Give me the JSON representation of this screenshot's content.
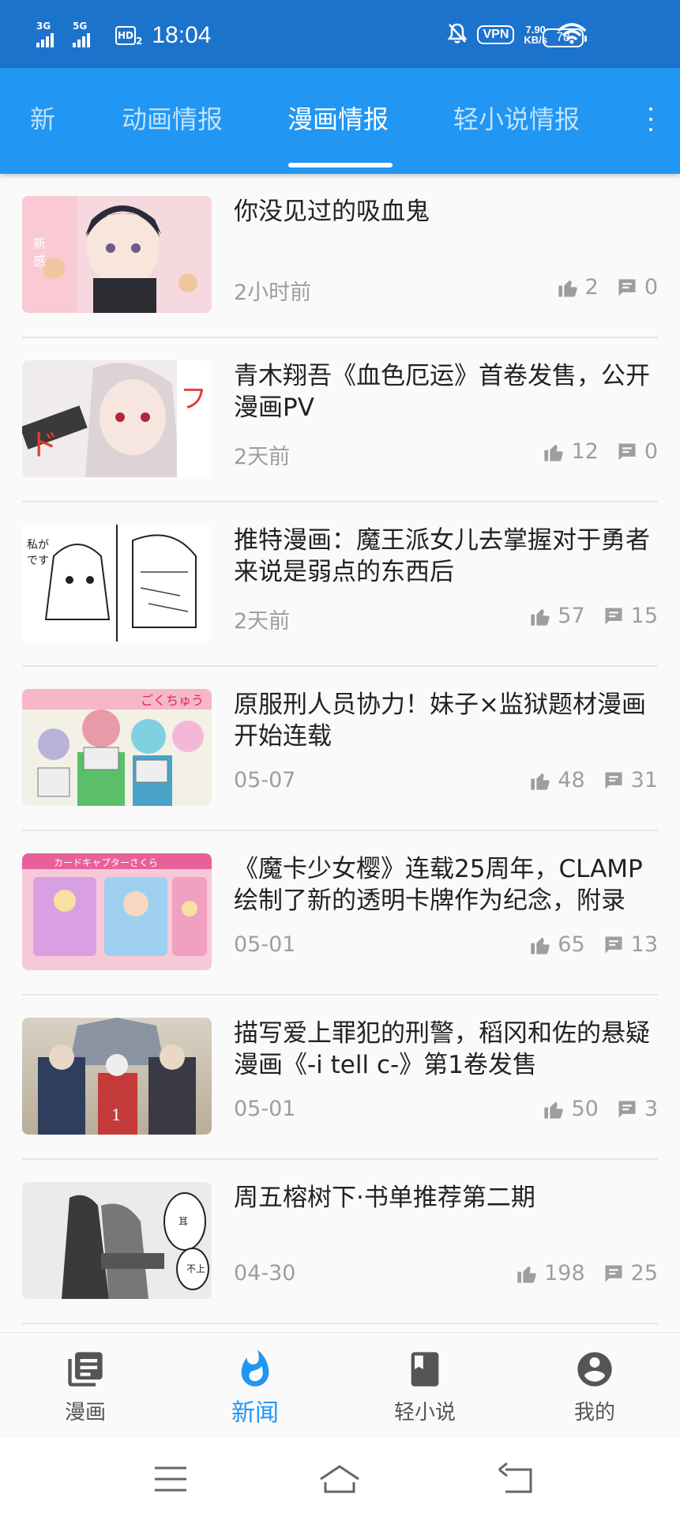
{
  "status_bar": {
    "sim1": "3G",
    "sim2": "5G",
    "hd": "HD",
    "hd_sub": "2",
    "time": "18:04",
    "vpn": "VPN",
    "net_speed_value": "7.90",
    "net_speed_unit": "KB/s",
    "battery": "78"
  },
  "tabs": [
    {
      "label": "新",
      "active": false
    },
    {
      "label": "动画情报",
      "active": false
    },
    {
      "label": "漫画情报",
      "active": true
    },
    {
      "label": "轻小说情报",
      "active": false
    }
  ],
  "news": [
    {
      "title": "你没见过的吸血鬼",
      "date": "2小时前",
      "likes": "2",
      "comments": "0"
    },
    {
      "title": "青木翔吾《血色厄运》首卷发售，公开漫画PV",
      "date": "2天前",
      "likes": "12",
      "comments": "0"
    },
    {
      "title": "推特漫画：魔王派女儿去掌握对于勇者来说是弱点的东西后",
      "date": "2天前",
      "likes": "57",
      "comments": "15"
    },
    {
      "title": "原服刑人员协力！妹子×监狱题材漫画开始连载",
      "date": "05-07",
      "likes": "48",
      "comments": "31"
    },
    {
      "title": "《魔卡少女樱》连载25周年，CLAMP绘制了新的透明卡牌作为纪念，附录",
      "date": "05-01",
      "likes": "65",
      "comments": "13"
    },
    {
      "title": "描写爱上罪犯的刑警，稻冈和佐的悬疑漫画《-i tell c-》第1卷发售",
      "date": "05-01",
      "likes": "50",
      "comments": "3"
    },
    {
      "title": "周五榕树下·书单推荐第二期",
      "date": "04-30",
      "likes": "198",
      "comments": "25"
    }
  ],
  "bottom_nav": [
    {
      "label": "漫画",
      "icon": "book-list-icon",
      "active": false
    },
    {
      "label": "新闻",
      "icon": "flame-icon",
      "active": true
    },
    {
      "label": "轻小说",
      "icon": "bookmark-book-icon",
      "active": false
    },
    {
      "label": "我的",
      "icon": "account-icon",
      "active": false
    }
  ],
  "colors": {
    "status_bar": "#1c73cc",
    "tab_bar": "#2196f3",
    "accent": "#2196f3",
    "meta_text": "#9e9e9e"
  }
}
